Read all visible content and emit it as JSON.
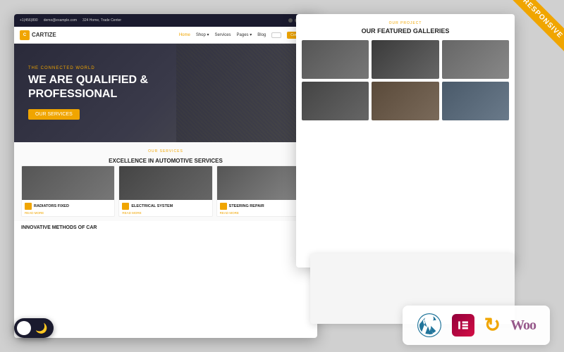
{
  "page": {
    "background_color": "#d0d0d0"
  },
  "responsive_badge": {
    "text": "RESPONSIVE"
  },
  "left_card": {
    "topbar": {
      "phone": "+1(456)890",
      "email": "demo@example.com",
      "address": "324 Home, Trade Center"
    },
    "navbar": {
      "logo_text": "CARTIZE",
      "nav_links": [
        "Home",
        "Shop",
        "Services",
        "Pages",
        "Blog"
      ],
      "btn_label": "Contact Us"
    },
    "hero": {
      "subtitle": "THE CONNECTED WORLD",
      "title": "WE ARE QUALIFIED &\nPROFESSIONAL",
      "btn_label": "OUR SERVICES"
    },
    "services": {
      "section_label": "OUR SERVICES",
      "section_title": "EXCELLENCE IN AUTOMOTIVE SERVICES",
      "items": [
        {
          "name": "RADIATORS FIXED",
          "read_more": "READ MORE"
        },
        {
          "name": "ELECTRICAL SYSTEM",
          "read_more": "READ MORE"
        },
        {
          "name": "STEERING REPAIR",
          "read_more": "READ MORE"
        }
      ]
    },
    "innovative": {
      "title": "INNOVATIVE METHODS OF CAR"
    }
  },
  "right_card": {
    "galleries": {
      "label": "OUR PROJECT",
      "title": "OUR FEATURED GALLERIES",
      "thumbs": [
        "thumb1",
        "thumb2",
        "thumb3",
        "thumb4",
        "thumb5",
        "thumb6"
      ]
    }
  },
  "dark_toggle": {
    "moon_icon": "🌙"
  },
  "tech_badges": {
    "wordpress_label": "WordPress",
    "elementor_label": "Elementor",
    "woocommerce_label": "Woo",
    "refresh_label": "↻"
  }
}
